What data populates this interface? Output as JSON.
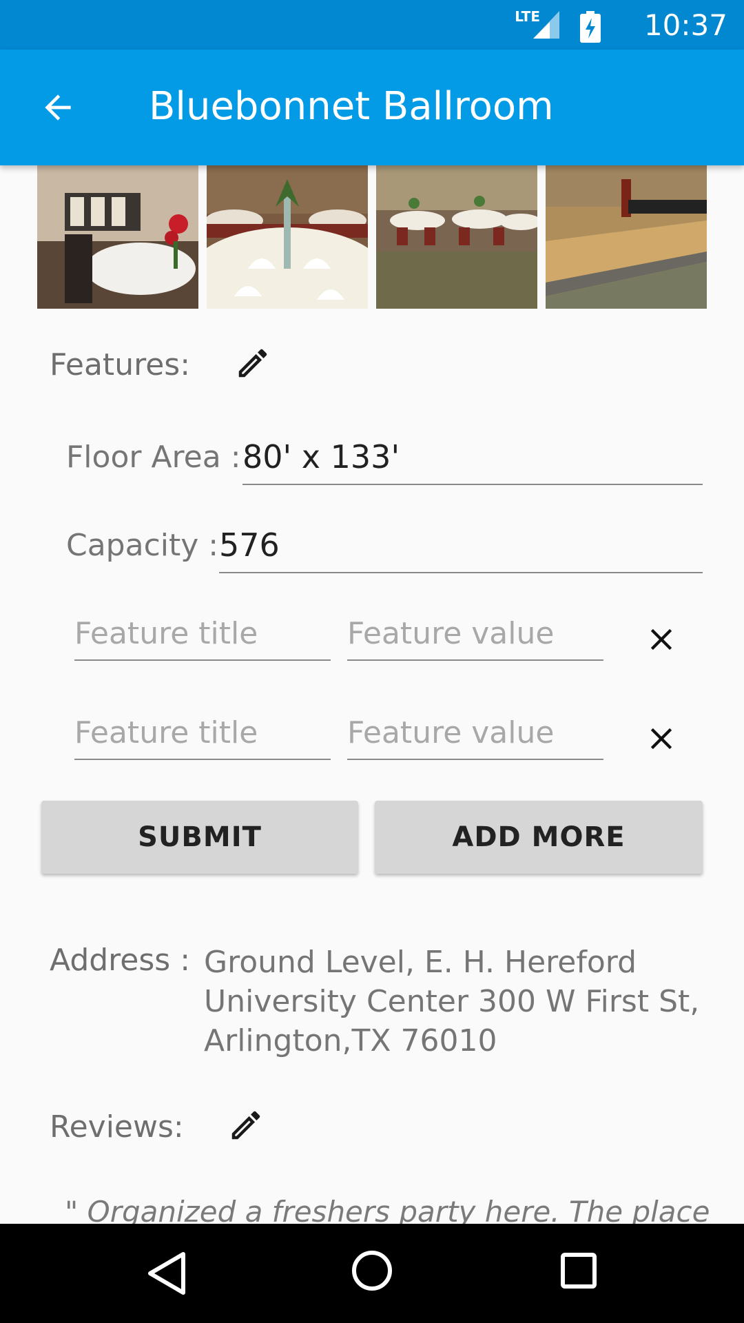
{
  "status_bar": {
    "network": "LTE",
    "time": "10:37"
  },
  "app_bar": {
    "title": "Bluebonnet Ballroom",
    "back_icon": "arrow-back-icon"
  },
  "gallery": [
    {
      "name": "banquet-table-photo"
    },
    {
      "name": "table-centerpiece-photo"
    },
    {
      "name": "ballroom-tables-photo"
    },
    {
      "name": "dance-floor-photo"
    }
  ],
  "features": {
    "label": "Features:",
    "edit_icon": "pencil-icon",
    "floor_area": {
      "label": "Floor Area :",
      "value": "80' x 133'"
    },
    "capacity": {
      "label": "Capacity :",
      "value": "576"
    },
    "custom_rows": [
      {
        "title_placeholder": "Feature title",
        "value_placeholder": "Feature value",
        "remove_icon": "close-icon"
      },
      {
        "title_placeholder": "Feature title",
        "value_placeholder": "Feature value",
        "remove_icon": "close-icon"
      }
    ],
    "submit_label": "SUBMIT",
    "add_more_label": "ADD MORE"
  },
  "address": {
    "label": "Address :",
    "value": "Ground Level, E. H. Hereford University Center 300 W First St, Arlington,TX 76010"
  },
  "reviews": {
    "label": "Reviews:",
    "edit_icon": "pencil-icon",
    "first_review": "\" Organized a freshers party here. The place"
  },
  "colors": {
    "status_bar": "#0288d1",
    "app_bar": "#039be5",
    "button": "#d6d6d6"
  }
}
